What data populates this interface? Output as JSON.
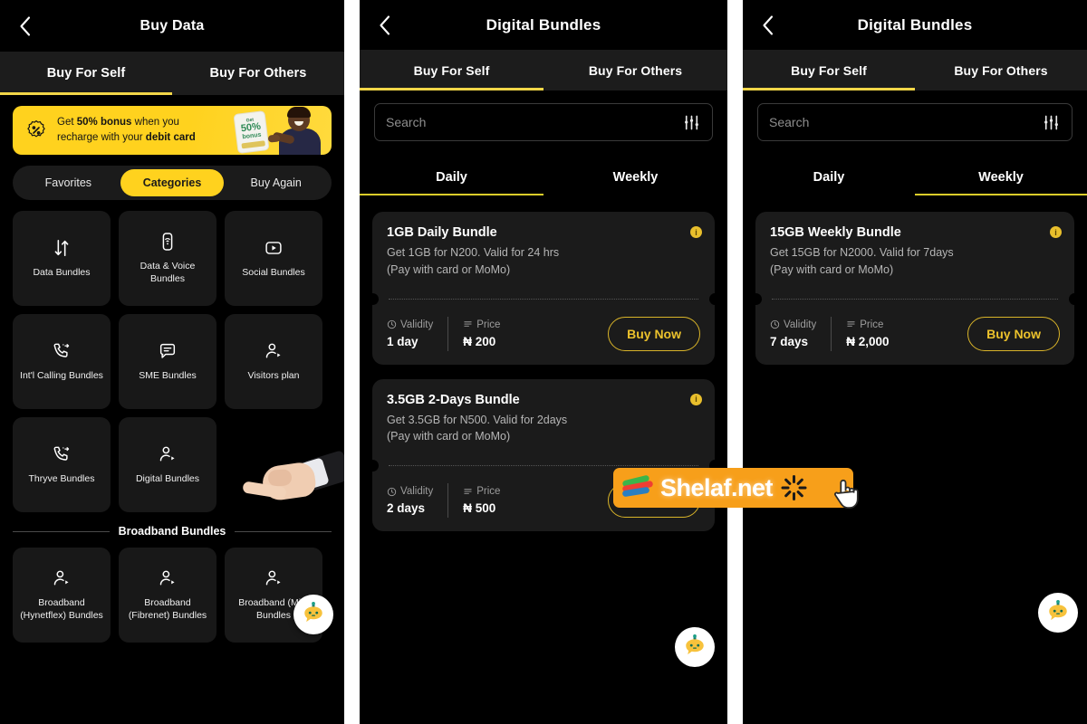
{
  "panels": [
    {
      "id": "buy-data",
      "header": {
        "title": "Buy Data",
        "back_icon": "chevron-left-icon"
      },
      "top_tabs": {
        "active_index": 0,
        "items": [
          {
            "label": "Buy For Self"
          },
          {
            "label": "Buy For Others"
          }
        ]
      },
      "banner": {
        "icon": "percent-badge-icon",
        "line1_pre": "Get ",
        "line1_bold": "50% bonus",
        "line1_post": " when you",
        "line2_pre": "recharge with your ",
        "line2_bold": "debit card",
        "art_line1": "Get",
        "art_line2": "50%",
        "art_line3": "bonus"
      },
      "segment": {
        "active_index": 1,
        "items": [
          {
            "label": "Favorites"
          },
          {
            "label": "Categories"
          },
          {
            "label": "Buy Again"
          }
        ]
      },
      "categories": [
        {
          "label": "Data Bundles",
          "icon": "data-transfer-icon"
        },
        {
          "label": "Data & Voice Bundles",
          "icon": "device-wifi-icon"
        },
        {
          "label": "Social Bundles",
          "icon": "play-square-icon"
        },
        {
          "label": "Int'l Calling Bundles",
          "icon": "phone-outgoing-icon"
        },
        {
          "label": "SME Bundles",
          "icon": "message-lines-icon"
        },
        {
          "label": "Visitors plan",
          "icon": "user-play-icon"
        },
        {
          "label": "Thryve Bundles",
          "icon": "phone-outgoing-icon"
        },
        {
          "label": "Digital Bundles",
          "icon": "user-play-icon"
        }
      ],
      "section_divider": {
        "title": "Broadband Bundles"
      },
      "broadband": [
        {
          "label": "Broadband (Hynetflex) Bundles",
          "icon": "user-play-icon"
        },
        {
          "label": "Broadband (Fibrenet) Bundles",
          "icon": "user-play-icon"
        },
        {
          "label": "Broadband (Mifi) Bundles",
          "icon": "user-play-icon"
        }
      ],
      "fab": {
        "icon": "chatbot-icon"
      }
    },
    {
      "id": "digital-bundles-daily",
      "header": {
        "title": "Digital Bundles",
        "back_icon": "chevron-left-icon"
      },
      "top_tabs": {
        "active_index": 0,
        "items": [
          {
            "label": "Buy For Self"
          },
          {
            "label": "Buy For Others"
          }
        ]
      },
      "search": {
        "placeholder": "Search",
        "value": "",
        "filter_icon": "sliders-icon"
      },
      "period_tabs": {
        "active_index": 0,
        "items": [
          {
            "label": "Daily"
          },
          {
            "label": "Weekly"
          }
        ]
      },
      "cards": [
        {
          "title": "1GB Daily Bundle",
          "desc_line1": "Get 1GB for N200. Valid for 24 hrs",
          "desc_line2": "(Pay with card or MoMo)",
          "info_badge": "i",
          "validity_label": "Validity",
          "validity_value": "1 day",
          "price_label": "Price",
          "price_value": "₦ 200",
          "buy_label": "Buy Now"
        },
        {
          "title": "3.5GB 2-Days Bundle",
          "desc_line1": "Get 3.5GB for N500. Valid for 2days",
          "desc_line2": "(Pay with card or MoMo)",
          "info_badge": "i",
          "validity_label": "Validity",
          "validity_value": "2 days",
          "price_label": "Price",
          "price_value": "₦ 500",
          "buy_label": "Buy Now"
        }
      ],
      "fab": {
        "icon": "chatbot-icon"
      }
    },
    {
      "id": "digital-bundles-weekly",
      "header": {
        "title": "Digital Bundles",
        "back_icon": "chevron-left-icon"
      },
      "top_tabs": {
        "active_index": 0,
        "items": [
          {
            "label": "Buy For Self"
          },
          {
            "label": "Buy For Others"
          }
        ]
      },
      "search": {
        "placeholder": "Search",
        "value": "",
        "filter_icon": "sliders-icon"
      },
      "period_tabs": {
        "active_index": 1,
        "items": [
          {
            "label": "Daily"
          },
          {
            "label": "Weekly"
          }
        ]
      },
      "cards": [
        {
          "title": "15GB Weekly Bundle",
          "desc_line1": "Get 15GB for N2000. Valid for 7days",
          "desc_line2": "(Pay with card or MoMo)",
          "info_badge": "i",
          "validity_label": "Validity",
          "validity_value": "7 days",
          "price_label": "Price",
          "price_value": "₦ 2,000",
          "buy_label": "Buy Now"
        }
      ],
      "fab": {
        "icon": "chatbot-icon"
      }
    }
  ],
  "watermark": {
    "text": "Shelaf.net",
    "icon": "shelaf-logo-icon",
    "cursor_icon": "hand-cursor-icon"
  },
  "colors": {
    "accent_yellow": "#ffd21e",
    "tab_underline": "#f2d648",
    "period_underline": "#dbcd2a",
    "card_bg": "#1b1b1b",
    "tile_bg": "#181818",
    "page_bg": "#000000",
    "buy_btn_border": "#d9b429",
    "buy_btn_text": "#ecc22c",
    "watermark_bg": "#f79f1a"
  }
}
